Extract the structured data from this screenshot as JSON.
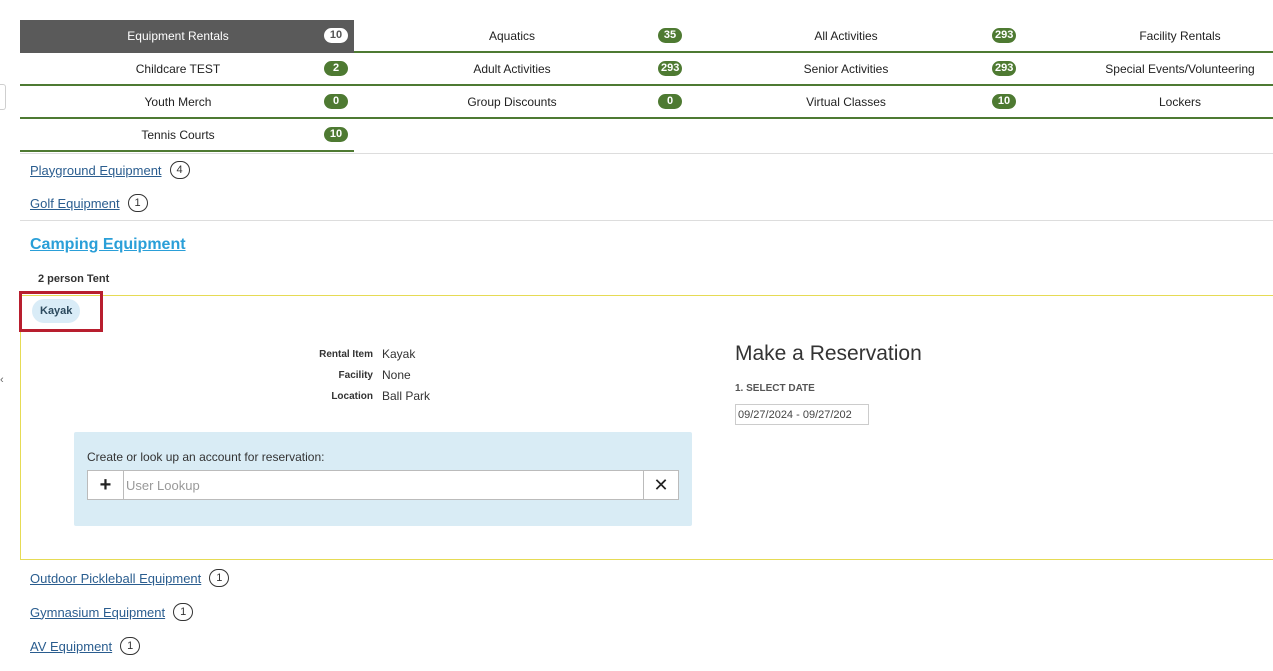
{
  "categories": {
    "rows": [
      [
        {
          "label": "Equipment Rentals",
          "count": "10",
          "active": true
        },
        {
          "label": "Aquatics",
          "count": "35"
        },
        {
          "label": "All Activities",
          "count": "293"
        },
        {
          "label": "Facility Rentals",
          "count": ""
        }
      ],
      [
        {
          "label": "Childcare TEST",
          "count": "2"
        },
        {
          "label": "Adult Activities",
          "count": "293"
        },
        {
          "label": "Senior Activities",
          "count": "293"
        },
        {
          "label": "Special Events/Volunteering",
          "count": ""
        }
      ],
      [
        {
          "label": "Youth Merch",
          "count": "0"
        },
        {
          "label": "Group Discounts",
          "count": "0"
        },
        {
          "label": "Virtual Classes",
          "count": "10"
        },
        {
          "label": "Lockers",
          "count": ""
        }
      ],
      [
        {
          "label": "Tennis Courts",
          "count": "10"
        }
      ]
    ]
  },
  "equipment": {
    "playground": {
      "label": "Playground Equipment",
      "count": "4"
    },
    "golf": {
      "label": "Golf Equipment",
      "count": "1"
    },
    "camping": {
      "label": "Camping Equipment"
    },
    "tent": {
      "label": "2 person Tent"
    },
    "kayak": {
      "label": "Kayak"
    },
    "pickleball": {
      "label": "Outdoor Pickleball Equipment",
      "count": "1"
    },
    "gymnasium": {
      "label": "Gymnasium Equipment",
      "count": "1"
    },
    "av": {
      "label": "AV Equipment",
      "count": "1"
    }
  },
  "details": {
    "rental_item": {
      "key": "Rental Item",
      "value": "Kayak"
    },
    "facility": {
      "key": "Facility",
      "value": "None"
    },
    "location": {
      "key": "Location",
      "value": "Ball Park"
    }
  },
  "lookup": {
    "label": "Create or look up an account for reservation:",
    "add_symbol": "+",
    "placeholder": "User Lookup",
    "clear_symbol": "✕"
  },
  "reservation": {
    "title": "Make a Reservation",
    "step_label": "1. SELECT DATE",
    "date_value": "09/27/2024 - 09/27/202"
  },
  "colors": {
    "accent_green": "#4e7a32",
    "active_tab": "#5a5a5a",
    "link_blue": "#2a5d8f",
    "highlight_red": "#b81e2e",
    "panel_border": "#e6db55",
    "lookup_bg": "#d9ecf5"
  }
}
